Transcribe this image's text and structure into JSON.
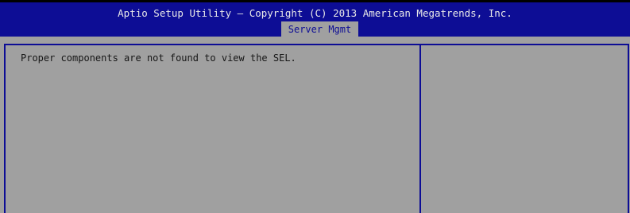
{
  "header": {
    "title": "Aptio Setup Utility – Copyright (C) 2013 American Megatrends, Inc.",
    "active_tab": "Server Mgmt"
  },
  "main": {
    "message": "Proper components are not found to view the SEL."
  },
  "colors": {
    "header_background": "#0d0d95",
    "panel_background": "#a0a0a0",
    "border": "#0d0d95",
    "header_text": "#e8e8e8",
    "body_text": "#161616"
  }
}
